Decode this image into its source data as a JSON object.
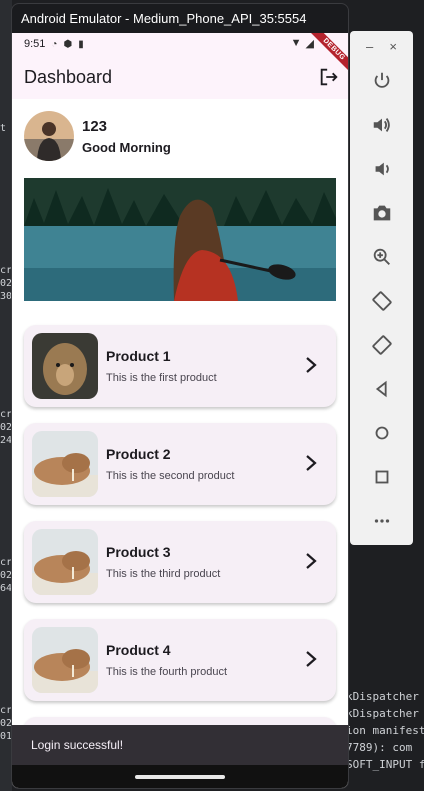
{
  "window": {
    "title": "Android Emulator - Medium_Phone_API_35:5554"
  },
  "status_bar": {
    "time": "9:51",
    "debug_label": "DEBUG"
  },
  "app_bar": {
    "title": "Dashboard",
    "logout_icon": "logout-icon"
  },
  "profile": {
    "name": "123",
    "greeting": "Good Morning"
  },
  "products": [
    {
      "title": "Product 1",
      "description": "This is the first product",
      "image": "lion"
    },
    {
      "title": "Product 2",
      "description": "This is the second product",
      "image": "walrus"
    },
    {
      "title": "Product 3",
      "description": "This is the third product",
      "image": "walrus"
    },
    {
      "title": "Product 4",
      "description": "This is the fourth product",
      "image": "walrus"
    }
  ],
  "snackbar": {
    "message": "Login successful!"
  },
  "toolbar": {
    "controls": [
      "–",
      "×"
    ],
    "buttons": [
      "power",
      "volume-up",
      "volume-down",
      "camera",
      "zoom",
      "rotate-left",
      "rotate-right",
      "back",
      "home",
      "overview",
      "more"
    ]
  },
  "background": {
    "left_fragments": [
      "t a",
      "cr",
      "02",
      "30",
      "cr",
      "02",
      "24",
      "cr",
      "02",
      "64",
      "cr",
      "02",
      "01"
    ],
    "code_lines": [
      "kDispatcher",
      "",
      "kDispatcher",
      "ion manifest",
      "7789): com",
      "SOFT_INPUT fromV"
    ]
  },
  "colors": {
    "accent": "#fef7ff",
    "card": "#f6eff6",
    "snackbar": "#322f35"
  }
}
